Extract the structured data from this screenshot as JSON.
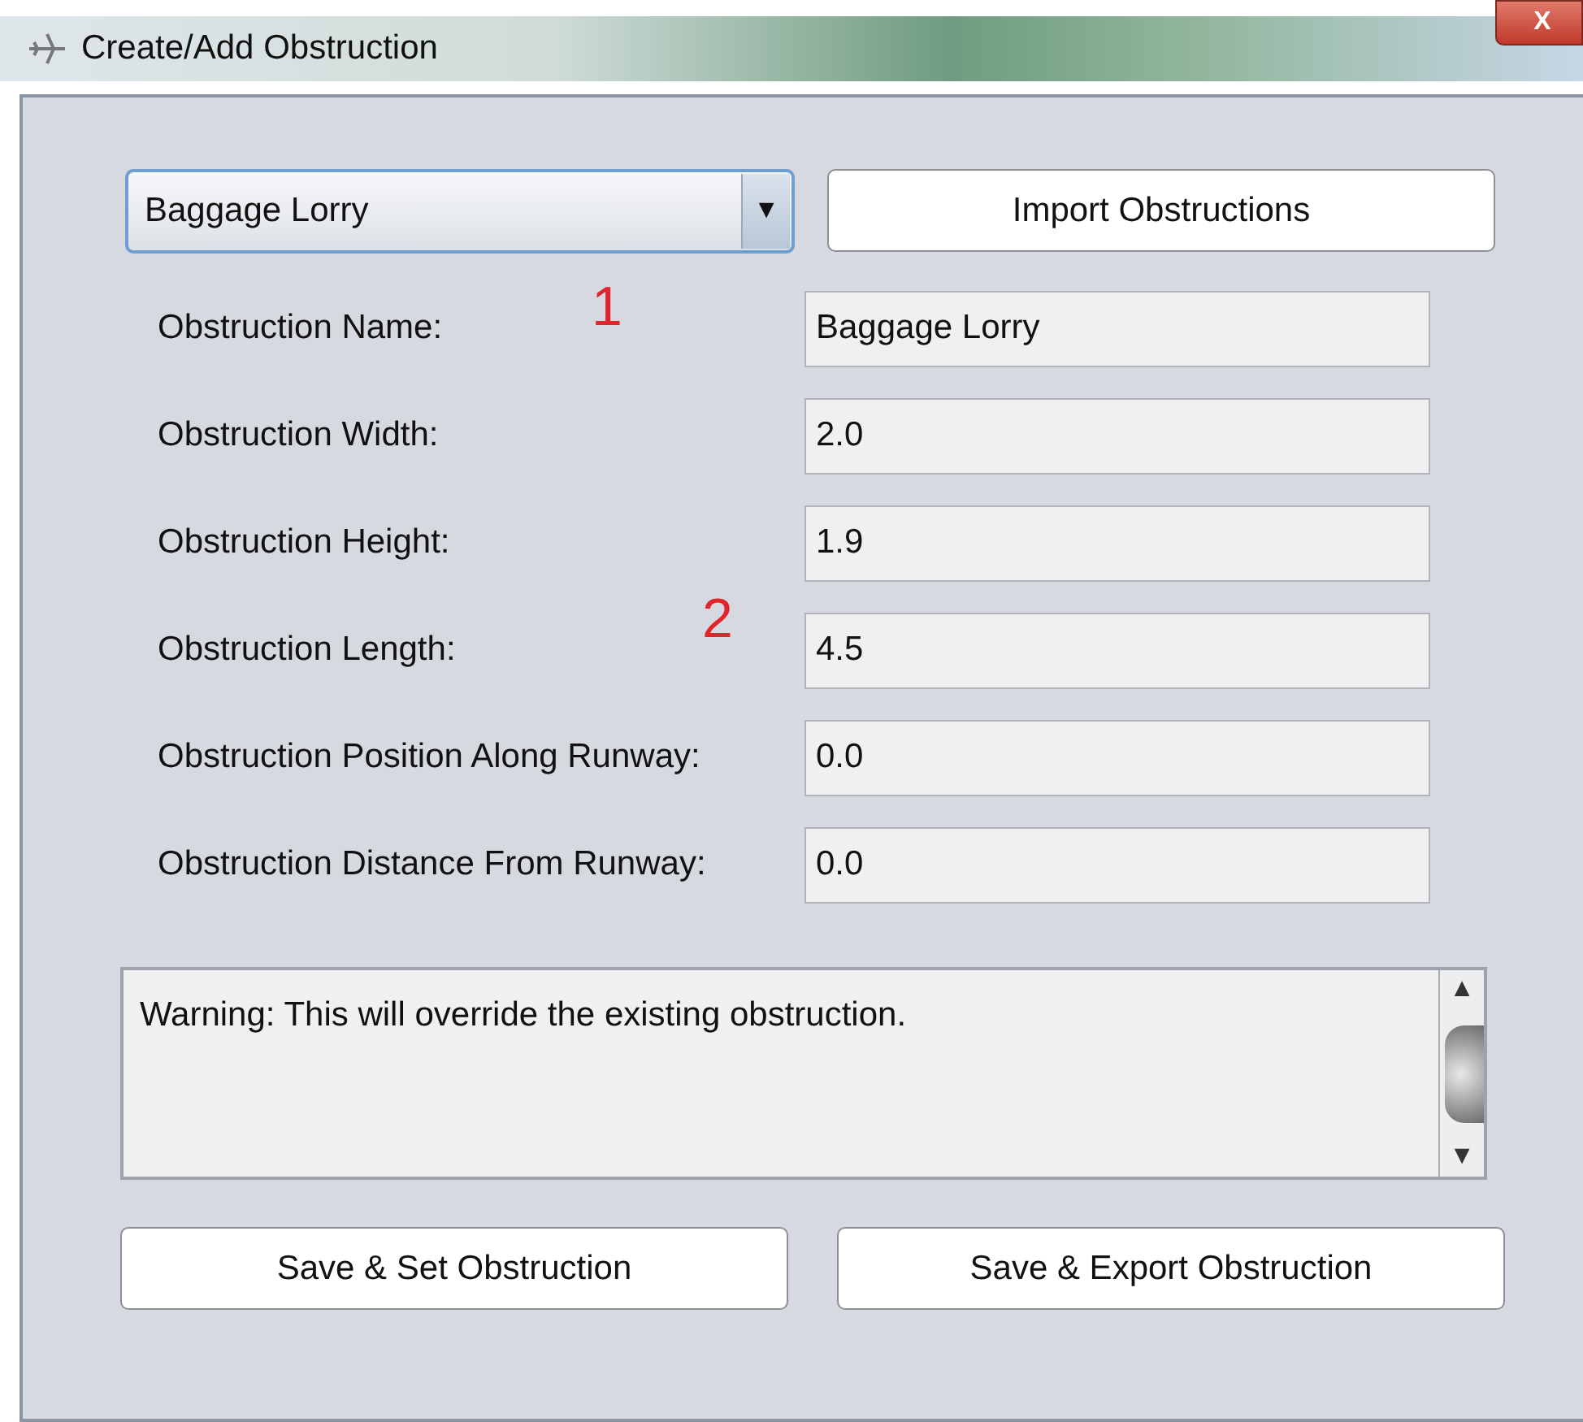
{
  "window": {
    "title": "Create/Add Obstruction",
    "close_label": "X"
  },
  "dropdown": {
    "value": "Baggage Lorry",
    "caret": "▼"
  },
  "import_button": "Import Obstructions",
  "fields": [
    {
      "label": "Obstruction Name:",
      "value": "Baggage Lorry"
    },
    {
      "label": "Obstruction Width:",
      "value": "2.0"
    },
    {
      "label": "Obstruction Height:",
      "value": "1.9"
    },
    {
      "label": "Obstruction Length:",
      "value": "4.5"
    },
    {
      "label": "Obstruction Position Along Runway:",
      "value": "0.0"
    },
    {
      "label": "Obstruction Distance From Runway:",
      "value": "0.0"
    }
  ],
  "message": "Warning: This will override the existing obstruction.",
  "scrollbar": {
    "up": "▲",
    "down": "▼"
  },
  "buttons": [
    "Save & Set Obstruction",
    "Save & Export Obstruction"
  ],
  "annotations": [
    "1",
    "2"
  ]
}
